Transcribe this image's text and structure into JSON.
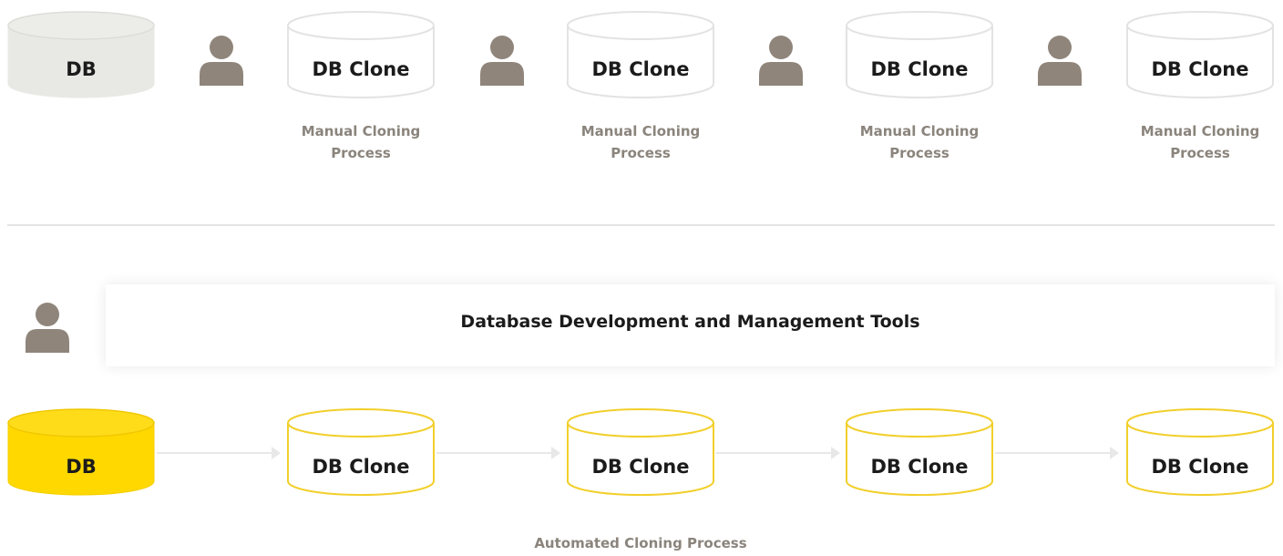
{
  "top_row": {
    "source_db": {
      "label": "DB",
      "fill": "#e8e9e4"
    },
    "clones": [
      {
        "label": "DB Clone",
        "caption": [
          "Manual Cloning",
          "Process"
        ]
      },
      {
        "label": "DB Clone",
        "caption": [
          "Manual Cloning",
          "Process"
        ]
      },
      {
        "label": "DB Clone",
        "caption": [
          "Manual Cloning",
          "Process"
        ]
      },
      {
        "label": "DB Clone",
        "caption": [
          "Manual Cloning",
          "Process"
        ]
      }
    ],
    "clone_stroke": "#e3e3e3"
  },
  "bottom_row": {
    "tools_label": "Database Development and Management Tools",
    "source_db": {
      "label": "DB",
      "fill": "#ffd800"
    },
    "clones": [
      {
        "label": "DB Clone"
      },
      {
        "label": "DB Clone"
      },
      {
        "label": "DB Clone"
      },
      {
        "label": "DB Clone"
      }
    ],
    "clone_stroke": "#f2cf2a",
    "caption": "Automated Cloning Process"
  },
  "colors": {
    "person": "#8f857b",
    "arrow": "#e8e8e8",
    "caption_text": "#8a847c"
  },
  "icons": {
    "person": "user-icon",
    "arrow": "arrow-right-icon"
  }
}
